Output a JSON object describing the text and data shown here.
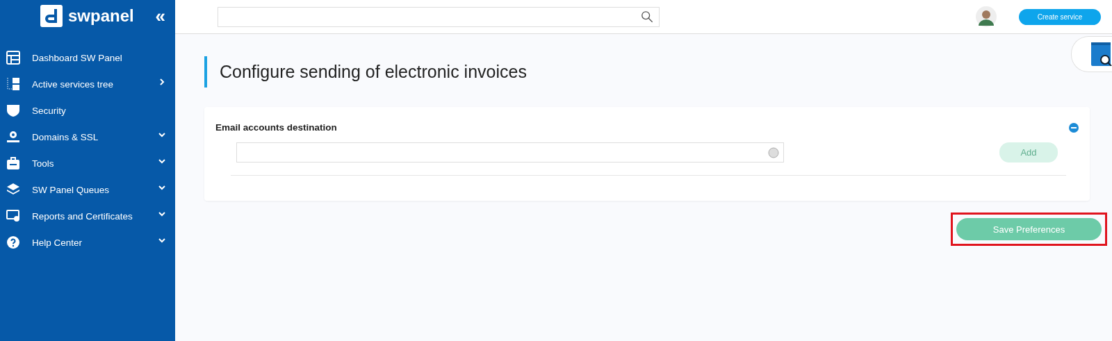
{
  "sidebar": {
    "logo": "swpanel",
    "collapse": "«",
    "items": [
      {
        "label": "Dashboard SW Panel",
        "kind": "plain"
      },
      {
        "label": "Active services tree",
        "kind": "link"
      },
      {
        "label": "Security",
        "kind": "plain"
      },
      {
        "label": "Domains & SSL",
        "kind": "dropdown"
      },
      {
        "label": "Tools",
        "kind": "dropdown"
      },
      {
        "label": "SW Panel Queues",
        "kind": "dropdown"
      },
      {
        "label": "Reports and Certificates",
        "kind": "dropdown"
      },
      {
        "label": "Help Center",
        "kind": "dropdown"
      }
    ]
  },
  "topbar": {
    "create_button": "Create service"
  },
  "page": {
    "title": "Configure sending of electronic invoices",
    "section": {
      "title": "Email accounts destination",
      "add_button": {
        "label": "Add",
        "disabled": true
      }
    },
    "save_button": {
      "label": "Save Preferences",
      "highlighted": true
    }
  }
}
